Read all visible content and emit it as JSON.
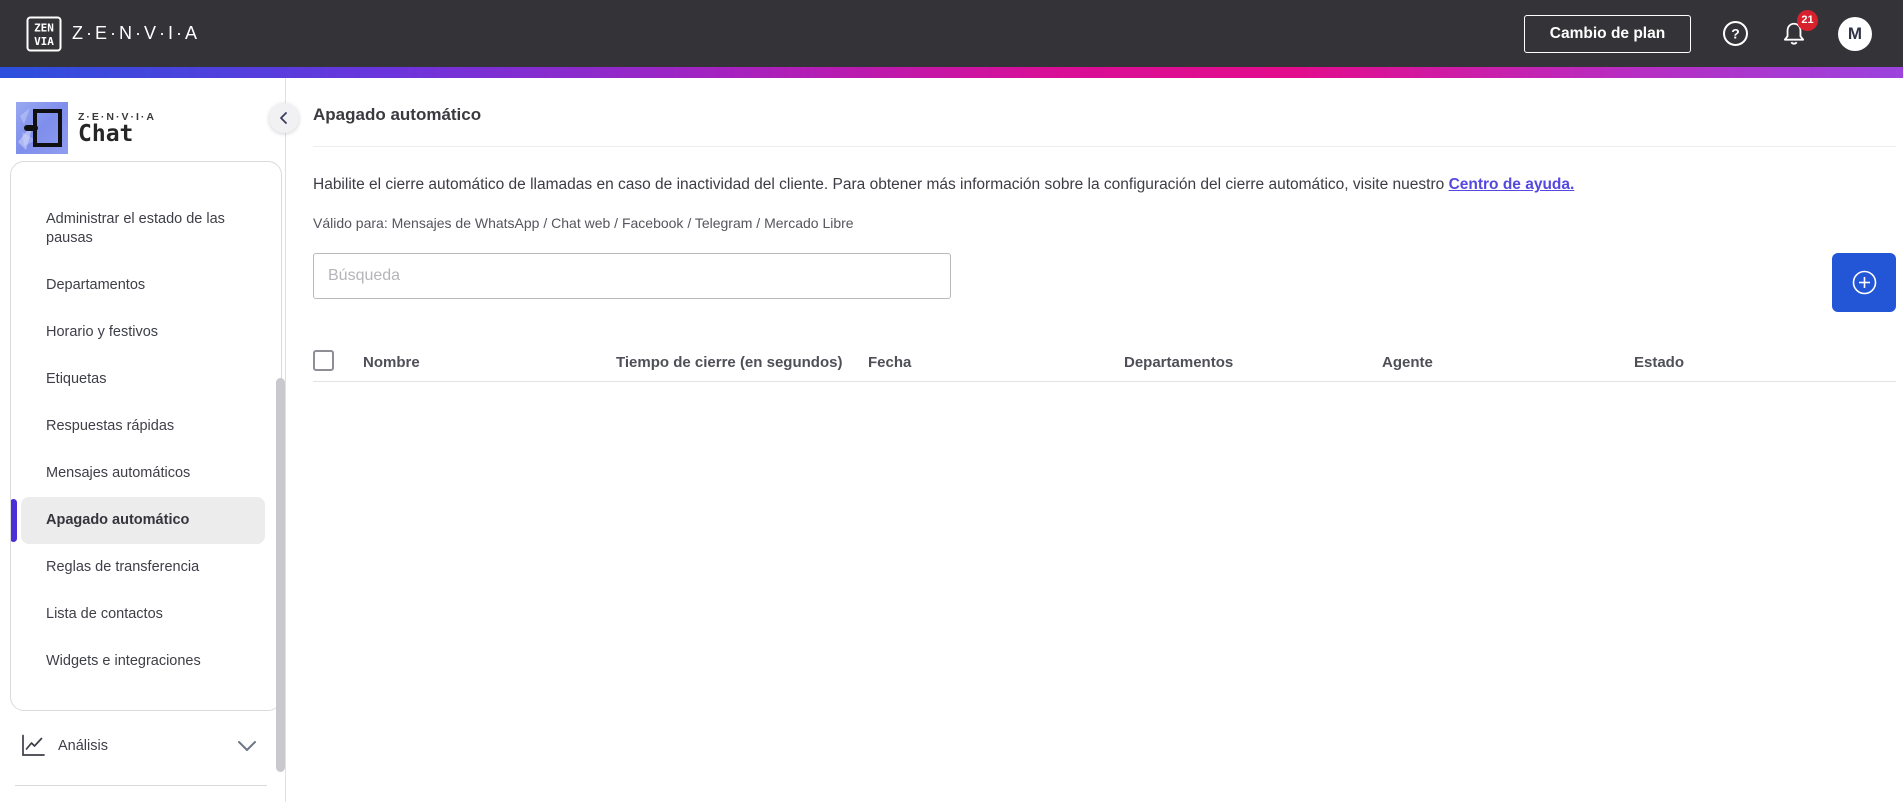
{
  "topbar": {
    "logo_top": "ZEN",
    "logo_bottom": "VIA",
    "brand": "Z·E·N·V·I·A",
    "change_plan_button": "Cambio de plan",
    "notifications_count": "21",
    "avatar_initial": "M"
  },
  "sidebar": {
    "brand_small": "Z·E·N·V·I·A",
    "product": "Chat",
    "items": [
      {
        "label": "Administrar el estado de las pausas",
        "active": false
      },
      {
        "label": "Departamentos",
        "active": false
      },
      {
        "label": "Horario y festivos",
        "active": false
      },
      {
        "label": "Etiquetas",
        "active": false
      },
      {
        "label": "Respuestas rápidas",
        "active": false
      },
      {
        "label": "Mensajes automáticos",
        "active": false
      },
      {
        "label": "Apagado automático",
        "active": true
      },
      {
        "label": "Reglas de transferencia",
        "active": false
      },
      {
        "label": "Lista de contactos",
        "active": false
      },
      {
        "label": "Widgets e integraciones",
        "active": false
      }
    ],
    "analysis_label": "Análisis"
  },
  "main": {
    "title": "Apagado automático",
    "description": "Habilite el cierre automático de llamadas en caso de inactividad del cliente. Para obtener más información sobre la configuración del cierre automático, visite nuestro",
    "help_link_label": "Centro de ayuda.",
    "valid_for": "Válido para: Mensajes de WhatsApp / Chat web / Facebook / Telegram / Mercado Libre",
    "search_placeholder": "Búsqueda",
    "table": {
      "columns": [
        "Nombre",
        "Tiempo de cierre (en segundos)",
        "Fecha",
        "Departamentos",
        "Agente",
        "Estado"
      ],
      "rows": []
    }
  },
  "colors": {
    "topbar_bg": "#343337",
    "accent_blue": "#2356d6",
    "active_indicator": "#4a2ed6",
    "link": "#5548e0",
    "badge_red": "#d7222d",
    "gradient": [
      "#2b50dd",
      "#6a35dd",
      "#a523c0",
      "#d80f97",
      "#e30c8c",
      "#9b44de"
    ]
  }
}
